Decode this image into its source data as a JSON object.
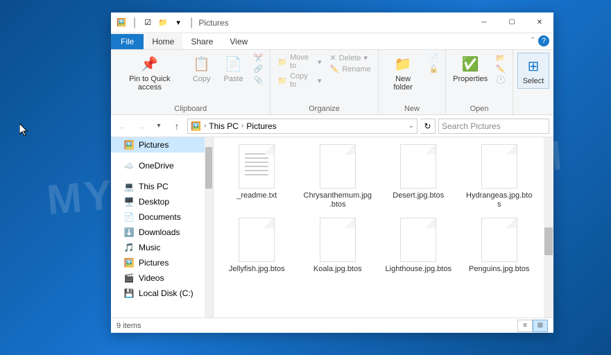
{
  "window": {
    "title": "Pictures",
    "tabs": {
      "file": "File",
      "home": "Home",
      "share": "Share",
      "view": "View"
    }
  },
  "ribbon": {
    "clipboard": {
      "label": "Clipboard",
      "pin": "Pin to Quick access",
      "copy": "Copy",
      "paste": "Paste"
    },
    "organize": {
      "label": "Organize",
      "moveto": "Move to",
      "copyto": "Copy to",
      "delete": "Delete",
      "rename": "Rename"
    },
    "new": {
      "label": "New",
      "newfolder": "New folder"
    },
    "open": {
      "label": "Open",
      "properties": "Properties"
    },
    "select": {
      "label": "Select"
    }
  },
  "address": {
    "crumb1": "This PC",
    "crumb2": "Pictures"
  },
  "search": {
    "placeholder": "Search Pictures"
  },
  "nav": {
    "items": [
      {
        "label": "Pictures",
        "icon": "🖼️",
        "selected": true
      },
      {
        "label": "OneDrive",
        "icon": "☁️"
      },
      {
        "label": "This PC",
        "icon": "💻"
      },
      {
        "label": "Desktop",
        "icon": "🖥️"
      },
      {
        "label": "Documents",
        "icon": "📄"
      },
      {
        "label": "Downloads",
        "icon": "⬇️"
      },
      {
        "label": "Music",
        "icon": "🎵"
      },
      {
        "label": "Pictures",
        "icon": "🖼️"
      },
      {
        "label": "Videos",
        "icon": "🎬"
      },
      {
        "label": "Local Disk (C:)",
        "icon": "💾"
      }
    ]
  },
  "files": [
    {
      "name": "_readme.txt",
      "type": "txt"
    },
    {
      "name": "Chrysanthemum.jpg.btos",
      "type": "file"
    },
    {
      "name": "Desert.jpg.btos",
      "type": "file"
    },
    {
      "name": "Hydrangeas.jpg.btos",
      "type": "file"
    },
    {
      "name": "Jellyfish.jpg.btos",
      "type": "file"
    },
    {
      "name": "Koala.jpg.btos",
      "type": "file"
    },
    {
      "name": "Lighthouse.jpg.btos",
      "type": "file"
    },
    {
      "name": "Penguins.jpg.btos",
      "type": "file"
    }
  ],
  "status": {
    "count": "9 items"
  }
}
